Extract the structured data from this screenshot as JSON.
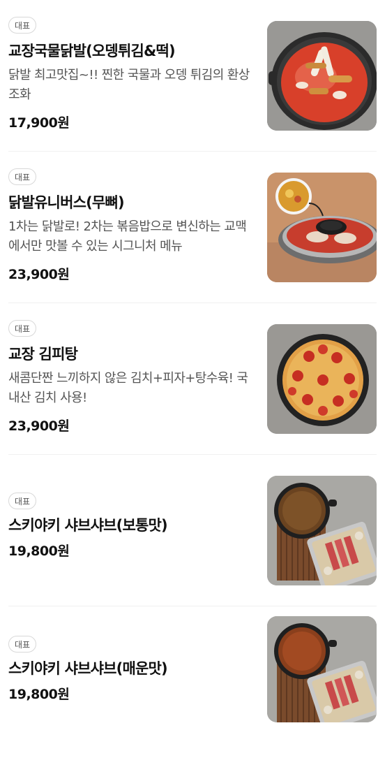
{
  "menu": {
    "items": [
      {
        "badge": "대표",
        "name": "교장국물닭발(오뎅튀김&떡)",
        "description": "닭발 최고맛집~!! 찐한 국물과 오뎅 튀김의 환상 조화",
        "price": "17,900원",
        "image_icon": "spicy-chicken-feet-soup-image"
      },
      {
        "badge": "대표",
        "name": "닭발유니버스(무뼈)",
        "description": "1차는 닭발로! 2차는 볶음밥으로 변신하는 교맥에서만 맛볼 수 있는 시그니처 메뉴",
        "price": "23,900원",
        "image_icon": "boneless-chicken-feet-pan-image"
      },
      {
        "badge": "대표",
        "name": "교장 김피탕",
        "description": "새콤단짠 느끼하지 않은 김치+피자+탕수육! 국내산 김치 사용!",
        "price": "23,900원",
        "image_icon": "kimchi-pizza-tangsuyuk-image"
      },
      {
        "badge": "대표",
        "name": "스키야키 샤브샤브(보통맛)",
        "description": "",
        "price": "19,800원",
        "image_icon": "sukiyaki-shabu-mild-image"
      },
      {
        "badge": "대표",
        "name": "스키야키 샤브샤브(매운맛)",
        "description": "",
        "price": "19,800원",
        "image_icon": "sukiyaki-shabu-spicy-image"
      }
    ]
  },
  "colors": {
    "text_primary": "#111111",
    "text_secondary": "#555555",
    "badge_border": "#d8d8d8",
    "divider": "#f0f0f0"
  }
}
